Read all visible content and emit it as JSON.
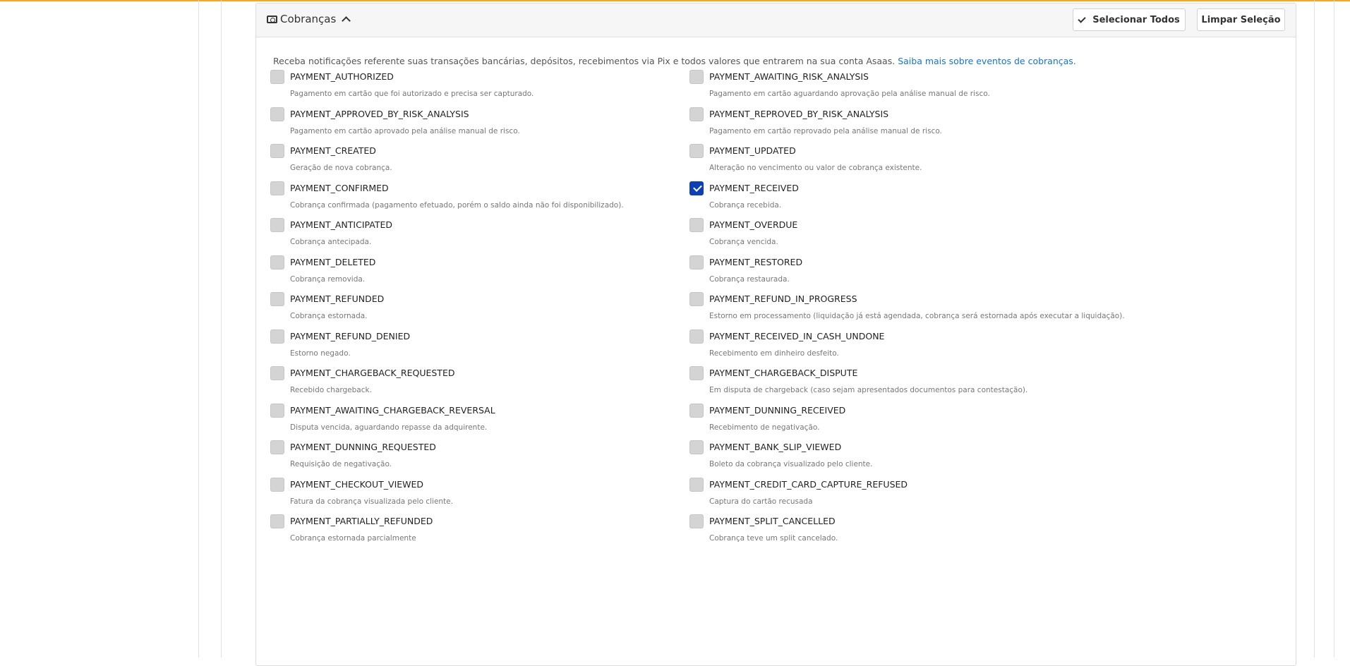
{
  "colors": {
    "accent_top": "#f5a623",
    "link": "#1474d4",
    "checkbox_checked": "#0c3fb8",
    "checkbox_unchecked": "#d4d4d4"
  },
  "section": {
    "title": "Cobranças",
    "title_icon": "money-icon",
    "toggle_icon": "chevron-up-icon",
    "select_all_label": "Selecionar Todos",
    "select_all_icon": "check-icon",
    "clear_label": "Limpar Seleção",
    "intro_text": "Receba notificações referente suas transações bancárias, depósitos, recebimentos via Pix e todos valores que entrarem na sua conta Asaas.",
    "intro_link": "Saiba mais sobre eventos de cobranças."
  },
  "events": [
    {
      "name": "PAYMENT_AUTHORIZED",
      "desc": "Pagamento em cartão que foi autorizado e precisa ser capturado.",
      "checked": false
    },
    {
      "name": "PAYMENT_AWAITING_RISK_ANALYSIS",
      "desc": "Pagamento em cartão aguardando aprovação pela análise manual de risco.",
      "checked": false
    },
    {
      "name": "PAYMENT_APPROVED_BY_RISK_ANALYSIS",
      "desc": "Pagamento em cartão aprovado pela análise manual de risco.",
      "checked": false
    },
    {
      "name": "PAYMENT_REPROVED_BY_RISK_ANALYSIS",
      "desc": "Pagamento em cartão reprovado pela análise manual de risco.",
      "checked": false
    },
    {
      "name": "PAYMENT_CREATED",
      "desc": "Geração de nova cobrança.",
      "checked": false
    },
    {
      "name": "PAYMENT_UPDATED",
      "desc": "Alteração no vencimento ou valor de cobrança existente.",
      "checked": false
    },
    {
      "name": "PAYMENT_CONFIRMED",
      "desc": "Cobrança confirmada (pagamento efetuado, porém o saldo ainda não foi disponibilizado).",
      "checked": false
    },
    {
      "name": "PAYMENT_RECEIVED",
      "desc": "Cobrança recebida.",
      "checked": true
    },
    {
      "name": "PAYMENT_ANTICIPATED",
      "desc": "Cobrança antecipada.",
      "checked": false
    },
    {
      "name": "PAYMENT_OVERDUE",
      "desc": "Cobrança vencida.",
      "checked": false
    },
    {
      "name": "PAYMENT_DELETED",
      "desc": "Cobrança removida.",
      "checked": false
    },
    {
      "name": "PAYMENT_RESTORED",
      "desc": "Cobrança restaurada.",
      "checked": false
    },
    {
      "name": "PAYMENT_REFUNDED",
      "desc": "Cobrança estornada.",
      "checked": false
    },
    {
      "name": "PAYMENT_REFUND_IN_PROGRESS",
      "desc": "Estorno em processamento (liquidação já está agendada, cobrança será estornada após executar a liquidação).",
      "checked": false
    },
    {
      "name": "PAYMENT_REFUND_DENIED",
      "desc": "Estorno negado.",
      "checked": false
    },
    {
      "name": "PAYMENT_RECEIVED_IN_CASH_UNDONE",
      "desc": "Recebimento em dinheiro desfeito.",
      "checked": false
    },
    {
      "name": "PAYMENT_CHARGEBACK_REQUESTED",
      "desc": "Recebido chargeback.",
      "checked": false
    },
    {
      "name": "PAYMENT_CHARGEBACK_DISPUTE",
      "desc": "Em disputa de chargeback (caso sejam apresentados documentos para contestação).",
      "checked": false
    },
    {
      "name": "PAYMENT_AWAITING_CHARGEBACK_REVERSAL",
      "desc": "Disputa vencida, aguardando repasse da adquirente.",
      "checked": false
    },
    {
      "name": "PAYMENT_DUNNING_RECEIVED",
      "desc": "Recebimento de negativação.",
      "checked": false
    },
    {
      "name": "PAYMENT_DUNNING_REQUESTED",
      "desc": "Requisição de negativação.",
      "checked": false
    },
    {
      "name": "PAYMENT_BANK_SLIP_VIEWED",
      "desc": "Boleto da cobrança visualizado pelo cliente.",
      "checked": false
    },
    {
      "name": "PAYMENT_CHECKOUT_VIEWED",
      "desc": "Fatura da cobrança visualizada pelo cliente.",
      "checked": false
    },
    {
      "name": "PAYMENT_CREDIT_CARD_CAPTURE_REFUSED",
      "desc": "Captura do cartão recusada",
      "checked": false
    },
    {
      "name": "PAYMENT_PARTIALLY_REFUNDED",
      "desc": "Cobrança estornada parcialmente",
      "checked": false
    },
    {
      "name": "PAYMENT_SPLIT_CANCELLED",
      "desc": "Cobrança teve um split cancelado.",
      "checked": false
    }
  ]
}
